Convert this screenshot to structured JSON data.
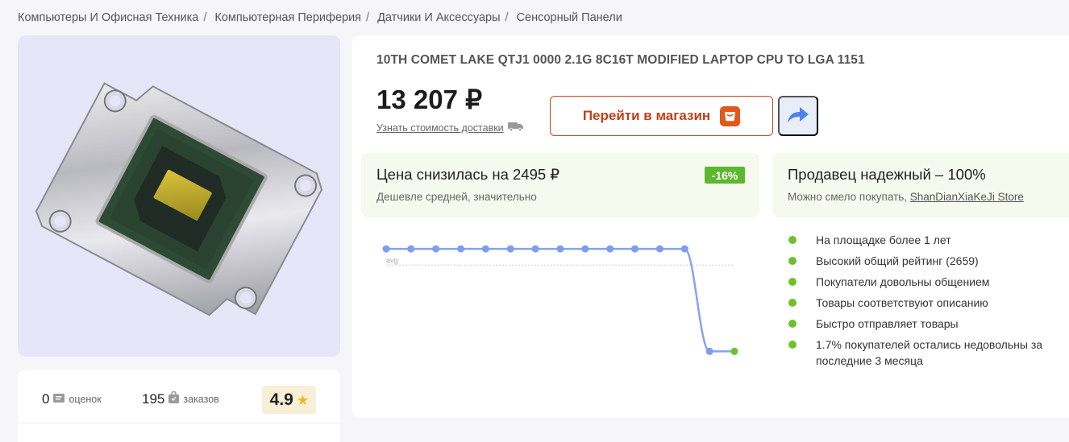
{
  "breadcrumb": [
    "Компьютеры И Офисная Техника",
    "Компьютерная Периферия",
    "Датчики И Аксессуары",
    "Сенсорный Панели"
  ],
  "breadcrumb_separator": "/",
  "product": {
    "title": "10TH COMET LAKE QTJ1 0000 2.1G 8C16T MODIFIED LAPTOP CPU TO LGA 1151",
    "price": "13 207 ₽",
    "delivery_link": "Узнать стоимость доставки"
  },
  "stats": {
    "ratings_count": "0",
    "ratings_label": "оценок",
    "orders_count": "195",
    "orders_label": "заказов",
    "score": "4.9"
  },
  "actions": {
    "shop_label": "Перейти в магазин"
  },
  "price_drop": {
    "headline": "Цена снизилась на 2495 ₽",
    "subline": "Дешевле средней, значительно",
    "badge": "-16%"
  },
  "seller": {
    "headline": "Продавец надежный – 100%",
    "subline_prefix": "Можно смело покупать, ",
    "store_name": "ShanDianXiaKeJi Store"
  },
  "chart_data": {
    "type": "line",
    "avg_label": "avg",
    "series": [
      {
        "values": [
          15702,
          15702,
          15702,
          15702,
          15702,
          15702,
          15702,
          15702,
          15702,
          15702,
          15702,
          15702,
          15702,
          13207,
          13207
        ]
      }
    ],
    "avg": 15307,
    "ylim": [
      13000,
      15900
    ],
    "grid": false,
    "colors": {
      "line": "#85a4ef",
      "point": "#7e9cf0",
      "last_point": "#6fc12b",
      "avg_line": "#d0d0d0"
    }
  },
  "seller_features": [
    "На площадке более 1 лет",
    "Высокий общий рейтинг (2659)",
    "Покупатели довольны общением",
    "Товары соответствуют описанию",
    "Быстро отправляет товары",
    "1.7% покупателей остались недовольны за последние 3 месяца"
  ],
  "colors": {
    "accent": "#c9451a",
    "good": "#6fc12b",
    "badge": "#5cb82e",
    "star": "#f0b723"
  },
  "icons": [
    "ratings-icon",
    "orders-bag-icon",
    "star-icon",
    "truck-icon",
    "shopping-bag-icon",
    "share-arrow-icon"
  ]
}
